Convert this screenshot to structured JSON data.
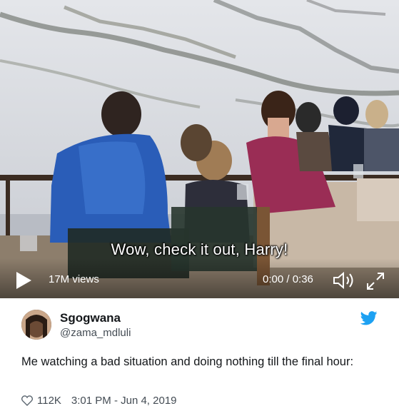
{
  "video": {
    "caption": "Wow, check it out, Harry!",
    "views": "17M views",
    "time": "0:00 / 0:36"
  },
  "tweet": {
    "display_name": "Sgogwana",
    "handle": "@zama_mdluli",
    "text": "Me watching a bad situation and doing nothing till the final hour:",
    "likes": "112K",
    "timestamp": "3:01 PM - Jun 4, 2019"
  },
  "icons": {
    "play": "play-icon",
    "volume": "volume-icon",
    "fullscreen": "fullscreen-icon",
    "twitter": "twitter-bird-icon",
    "like": "heart-icon"
  },
  "colors": {
    "twitter_blue": "#1da1f2",
    "text_primary": "#14171a",
    "text_secondary": "#444c54"
  }
}
